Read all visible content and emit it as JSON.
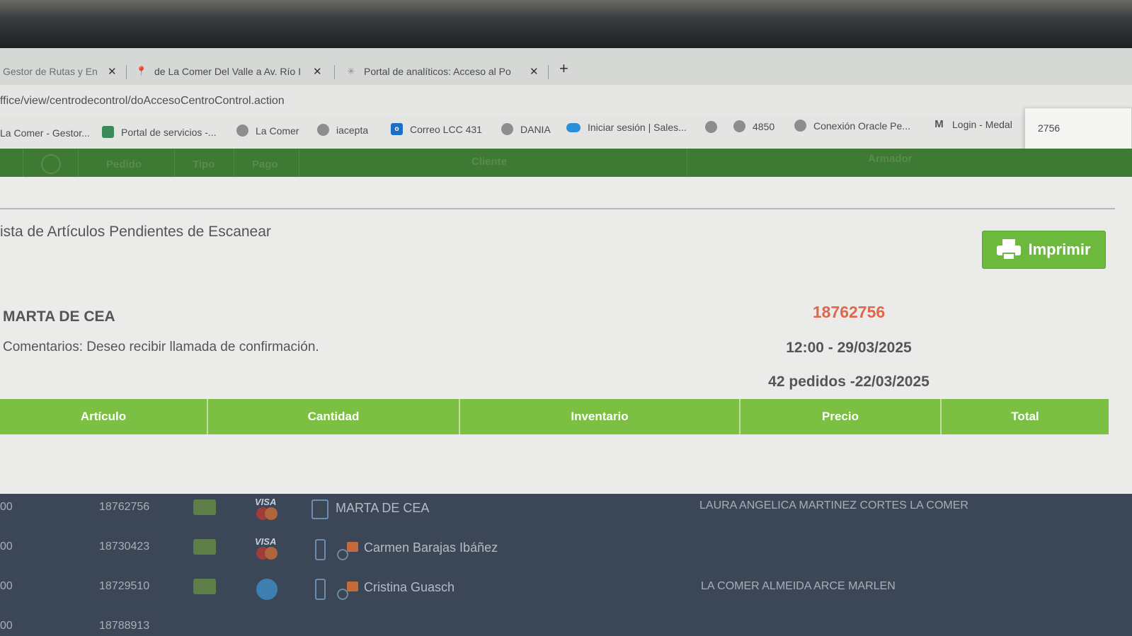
{
  "browser": {
    "tabs": [
      {
        "label": "Gestor de Rutas y En",
        "icon": "page-icon"
      },
      {
        "label": "de La Comer Del Valle a Av. Río I",
        "icon": "maps-pin-icon"
      },
      {
        "label": "Portal de analíticos: Acceso al Po",
        "icon": "loading-icon"
      }
    ],
    "url": "ffice/view/centrodecontrol/doAccesoCentroControl.action",
    "bookmarks": [
      {
        "label": "La Comer - Gestor...",
        "icon": "none"
      },
      {
        "label": "Portal de servicios -...",
        "icon": "square-app-icon"
      },
      {
        "label": "La Comer",
        "icon": "globe-icon"
      },
      {
        "label": "iacepta",
        "icon": "globe-icon"
      },
      {
        "label": "Correo LCC 431",
        "icon": "outlook-icon"
      },
      {
        "label": "DANIA",
        "icon": "globe-icon"
      },
      {
        "label": "Iniciar sesión | Sales...",
        "icon": "cloud-icon"
      },
      {
        "label": "",
        "icon": "globe-icon"
      },
      {
        "label": "4850",
        "icon": "globe-icon"
      },
      {
        "label": "Conexión Oracle Pe...",
        "icon": "globe-icon"
      },
      {
        "label": "Login - Medal",
        "icon": "medal-icon"
      }
    ],
    "find_value": "2756"
  },
  "background_header": {
    "columns": [
      "Pedido",
      "Tipo",
      "Pago",
      "Cliente",
      "Armador"
    ]
  },
  "modal": {
    "title": "ista de Artículos Pendientes de Escanear",
    "print_label": "Imprimir",
    "customer_name": "MARTA DE CEA",
    "comments": "Comentarios: Deseo recibir llamada de confirmación.",
    "order_number": "18762756",
    "delivery_slot": "12:00 - 29/03/2025",
    "orders_summary": "42 pedidos -22/03/2025",
    "table_headers": [
      "Artículo",
      "Cantidad",
      "Inventario",
      "Precio",
      "Total"
    ],
    "order_number_color": "#e0664c",
    "header_color": "#7bc043"
  },
  "background_rows": [
    {
      "time": "00",
      "order": "18762756",
      "payment": "VISA",
      "channel": "desktop",
      "client": "MARTA DE CEA",
      "picker": "LAURA ANGELICA MARTINEZ CORTES LA COMER"
    },
    {
      "time": "00",
      "order": "18730423",
      "payment": "VISA",
      "channel": "mobile",
      "client": "Carmen Barajas Ibáñez",
      "picker": ""
    },
    {
      "time": "00",
      "order": "18729510",
      "payment": "other",
      "channel": "mobile",
      "client": "Cristina Guasch",
      "picker": "LA COMER ALMEIDA ARCE MARLEN"
    },
    {
      "time": "00",
      "order": "18788913",
      "payment": "",
      "channel": "",
      "client": "",
      "picker": ""
    }
  ]
}
